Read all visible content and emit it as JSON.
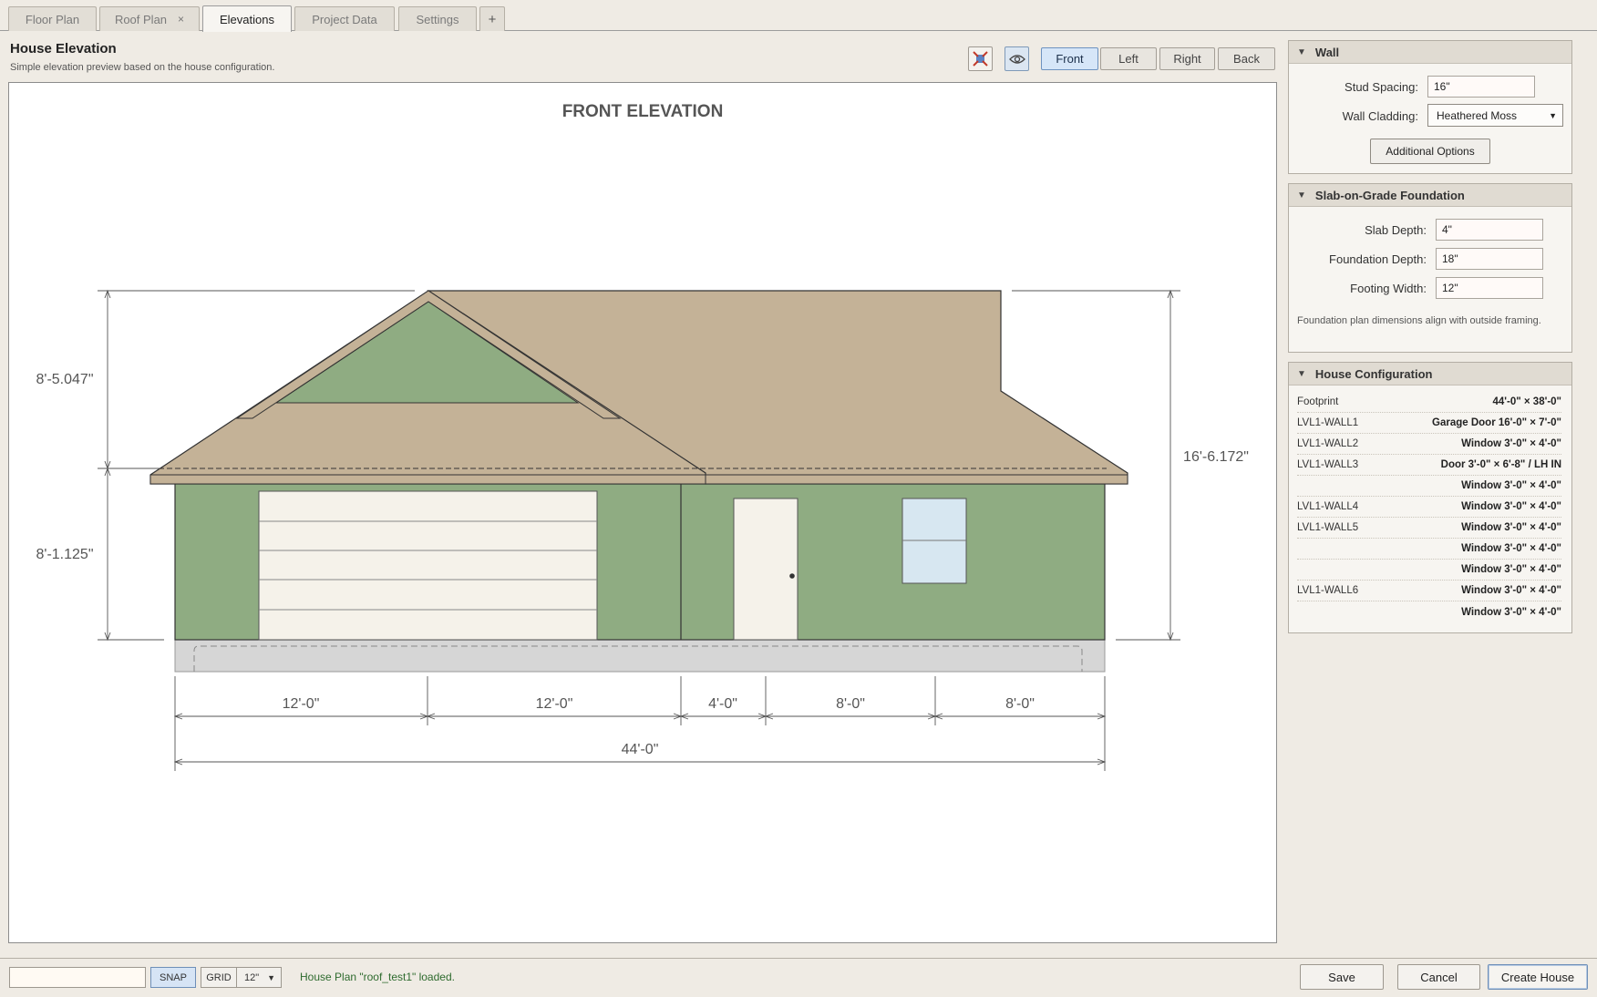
{
  "tabs": [
    {
      "label": "Floor Plan"
    },
    {
      "label": "Roof Plan",
      "close": "×"
    },
    {
      "label": "Elevations"
    },
    {
      "label": "Project Data"
    },
    {
      "label": "Settings"
    },
    {
      "label": "+"
    }
  ],
  "header": {
    "title": "House Elevation",
    "subtitle": "Simple elevation preview based on the house configuration."
  },
  "views": {
    "front": "Front",
    "left": "Left",
    "right": "Right",
    "back": "Back",
    "selected": "Front"
  },
  "icons": {
    "fit": "fit-view-icon",
    "visibility": "eye-icon"
  },
  "elevation": {
    "title": "FRONT ELEVATION",
    "dims": {
      "upper_left": "8'-5.047\"",
      "lower_left": "8'-1.125\"",
      "right_total": "16'-6.172\"",
      "seg1": "12'-0\"",
      "seg2": "12'-0\"",
      "seg3": "4'-0\"",
      "seg4": "8'-0\"",
      "seg5": "8'-0\"",
      "overall": "44'-0\""
    },
    "colors": {
      "roof": "#c4b297",
      "wall": "#8fac82",
      "gable": "#8fac82",
      "door": "#f5f2ea",
      "window": "#d7e7f1",
      "slab": "#d6d6d6"
    }
  },
  "wall_panel": {
    "title": "Wall",
    "stud_spacing_label": "Stud Spacing:",
    "stud_spacing": "16\"",
    "cladding_label": "Wall Cladding:",
    "cladding": "Heathered Moss",
    "options_button": "Additional Options"
  },
  "foundation_panel": {
    "title": "Slab-on-Grade Foundation",
    "slab_depth_label": "Slab Depth:",
    "slab_depth": "4\"",
    "foundation_depth_label": "Foundation Depth:",
    "foundation_depth": "18\"",
    "footing_width_label": "Footing Width:",
    "footing_width": "12\"",
    "note": "Foundation plan dimensions align with outside framing."
  },
  "config_panel": {
    "title": "House Configuration",
    "rows": [
      {
        "key": "Footprint",
        "value": "44'-0\" × 38'-0\""
      },
      {
        "key": "LVL1-WALL1",
        "value": "Garage Door 16'-0\" × 7'-0\""
      },
      {
        "key": "LVL1-WALL2",
        "value": "Window 3'-0\" × 4'-0\""
      },
      {
        "key": "LVL1-WALL3",
        "value": "Door 3'-0\" × 6'-8\" / LH IN"
      },
      {
        "key": "",
        "value": "Window 3'-0\" × 4'-0\""
      },
      {
        "key": "LVL1-WALL4",
        "value": "Window 3'-0\" × 4'-0\""
      },
      {
        "key": "LVL1-WALL5",
        "value": "Window 3'-0\" × 4'-0\""
      },
      {
        "key": "",
        "value": "Window 3'-0\" × 4'-0\""
      },
      {
        "key": "",
        "value": "Window 3'-0\" × 4'-0\""
      },
      {
        "key": "LVL1-WALL6",
        "value": "Window 3'-0\" × 4'-0\""
      },
      {
        "key": "",
        "value": "Window 3'-0\" × 4'-0\""
      }
    ]
  },
  "bottom": {
    "command_value": "",
    "snap": "SNAP",
    "grid": "GRID",
    "grid_size": "12\"",
    "status": "House Plan \"roof_test1\" loaded.",
    "save": "Save",
    "cancel": "Cancel",
    "create": "Create House"
  }
}
